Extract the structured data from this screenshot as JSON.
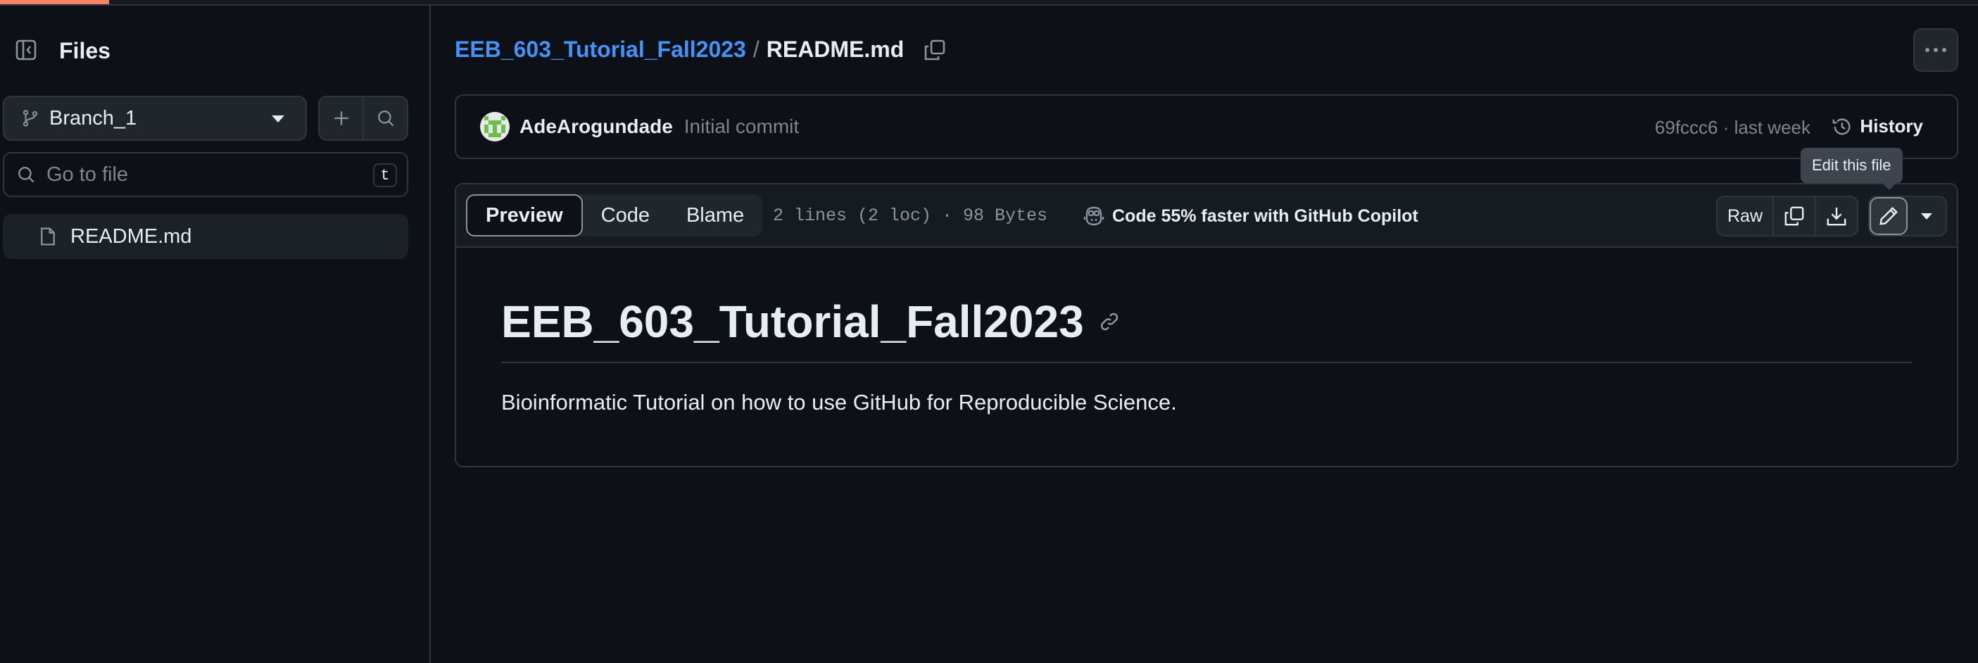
{
  "sidebar": {
    "title": "Files",
    "branch": "Branch_1",
    "search_placeholder": "Go to file",
    "shortcut_key": "t",
    "files": [
      "README.md"
    ]
  },
  "breadcrumb": {
    "repo": "EEB_603_Tutorial_Fall2023",
    "separator": "/",
    "file": "README.md"
  },
  "commit": {
    "author": "AdeArogundade",
    "message": "Initial commit",
    "hash_time": "69fccc6 · last week",
    "history_label": "History"
  },
  "file_header": {
    "tabs": [
      "Preview",
      "Code",
      "Blame"
    ],
    "active_tab": "Preview",
    "info": "2 lines (2 loc) · 98 Bytes",
    "copilot": "Code 55% faster with GitHub Copilot",
    "raw_label": "Raw",
    "tooltip": "Edit this file"
  },
  "readme": {
    "heading": "EEB_603_Tutorial_Fall2023",
    "paragraph": "Bioinformatic Tutorial on how to use GitHub for Reproducible Science."
  },
  "colors": {
    "background": "#0d1117",
    "link": "#4493f8",
    "accent": "#f78166",
    "border": "#30363d"
  }
}
